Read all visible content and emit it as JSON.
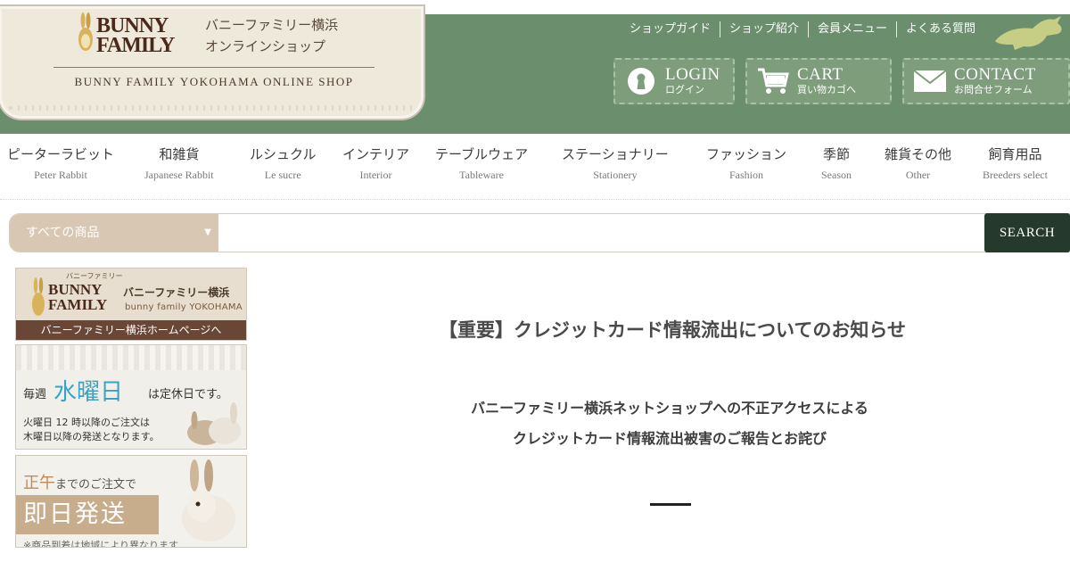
{
  "header": {
    "logo_word1": "BUNNY",
    "logo_word2": "FAMILY",
    "logo_jp_line1": "バニーファミリー横浜",
    "logo_jp_line2": "オンラインショップ",
    "logo_en": "BUNNY FAMILY YOKOHAMA ONLINE SHOP",
    "top_links": [
      "ショップガイド",
      "ショップ紹介",
      "会員メニュー",
      "よくある質問"
    ],
    "buttons": {
      "login": {
        "label": "LOGIN",
        "sub": "ログイン",
        "icon": "keyhole-icon"
      },
      "cart": {
        "label": "CART",
        "sub": "買い物カゴへ",
        "icon": "cart-icon"
      },
      "contact": {
        "label": "CONTACT",
        "sub": "お問合せフォーム",
        "icon": "envelope-icon"
      }
    },
    "colors": {
      "header_bg": "#6b8f6c",
      "button_bg": "#7d9d7b"
    }
  },
  "nav": [
    {
      "jp": "ピーターラビット",
      "en": "Peter Rabbit"
    },
    {
      "jp": "和雑貨",
      "en": "Japanese Rabbit"
    },
    {
      "jp": "ルシュクル",
      "en": "Le sucre"
    },
    {
      "jp": "インテリア",
      "en": "Interior"
    },
    {
      "jp": "テーブルウェア",
      "en": "Tableware"
    },
    {
      "jp": "ステーショナリー",
      "en": "Stationery"
    },
    {
      "jp": "ファッション",
      "en": "Fashion"
    },
    {
      "jp": "季節",
      "en": "Season"
    },
    {
      "jp": "雑貨その他",
      "en": "Other"
    },
    {
      "jp": "飼育用品",
      "en": "Breeders select"
    }
  ],
  "search": {
    "category": "すべての商品",
    "placeholder": "",
    "button": "SEARCH",
    "colors": {
      "category_bg": "#d8c8b3",
      "button_bg": "#253a2c"
    }
  },
  "sidebar": {
    "banner_home": {
      "ruby": "バニーファミリー",
      "word1": "BUNNY",
      "word2": "FAMILY",
      "name": "バニーファミリー横浜",
      "name_en": "bunny family YOKOHAMA",
      "link": "バニーファミリー横浜ホームページへ"
    },
    "banner_holiday": {
      "prefix": "毎週",
      "day": "水曜日",
      "suffix": "は定休日です。",
      "note1": "火曜日 12 時以降のご注文は",
      "note2": "木曜日以降の発送となります。"
    },
    "banner_sameday": {
      "noon": "正午",
      "line1_rest": "までのご注文で",
      "big": "即日発送",
      "note": "※商品到着は地域により異なります"
    }
  },
  "main": {
    "title": "【重要】クレジットカード情報流出についてのお知らせ",
    "subtitle_line1": "バニーファミリー横浜ネットショップへの不正アクセスによる",
    "subtitle_line2": "クレジットカード情報流出被害のご報告とお詫び"
  }
}
